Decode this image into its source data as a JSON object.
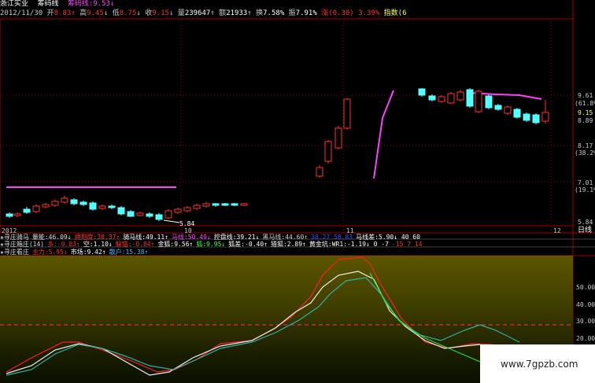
{
  "header": {
    "stock_name": "浙江实业",
    "indicator_name": "筹码线",
    "indicator_value": "9.53",
    "date": "2012/11/30",
    "open_label": "开",
    "open_value": "8.83",
    "high_label": "高",
    "high_value": "9.45",
    "low_label": "低",
    "low_value": "8.75",
    "close_label": "收",
    "close_value": "9.15",
    "volume_label": "量",
    "volume_value": "239647",
    "amount_label": "额",
    "amount_value": "21933",
    "turnover_label": "换",
    "turnover_value": "7.58%",
    "amplitude_label": "振",
    "amplitude_value": "7.91%",
    "change_label": "涨",
    "change_value": "(0.30)",
    "change_pct": "3.39%",
    "index_label": "指数(6"
  },
  "price_axis": {
    "ticks": [
      "9.61",
      "(61.8%)",
      "9.15",
      "8.89",
      "8.17",
      "(38.2%)",
      "7.01",
      "(19.1%)",
      "5.84"
    ],
    "low_marker": "5.84"
  },
  "date_axis": {
    "labels": [
      "2012",
      "10",
      "11",
      "12"
    ],
    "period_label": "日线"
  },
  "indicators": {
    "row1": [
      {
        "t": "寻庄骑马",
        "c": "#dcdcdc"
      },
      {
        "t": "量能:46.09↓",
        "c": "#dcdcdc"
      },
      {
        "t": "拥抱度:38.37↑",
        "c": "#ff3030"
      },
      {
        "t": "骑马线:49.11↑",
        "c": "#ffffff"
      },
      {
        "t": "马线:50.49↓",
        "c": "#ff40ff"
      },
      {
        "t": "控盘线:39.21↓",
        "c": "#ffffff"
      },
      {
        "t": "黑马线:44.60↑",
        "c": "#d0d0d0"
      },
      {
        "t": "38.27 58.83",
        "c": "#3050ff"
      },
      {
        "t": "马线差:5.90↓ 40 60",
        "c": "#ffffff"
      }
    ],
    "row2": [
      {
        "t": "寻庄箱庄(14)",
        "c": "#dcdcdc"
      },
      {
        "t": "多:-0.83↑",
        "c": "#ff3030"
      },
      {
        "t": "空:1.10↓",
        "c": "#ffffff"
      },
      {
        "t": "躲猫:-0.84↑",
        "c": "#ff3030"
      },
      {
        "t": "金狐:9.56↑",
        "c": "#ffffff"
      },
      {
        "t": "狐:9.95↓",
        "c": "#40ff40"
      },
      {
        "t": "狐差:-0.40↑",
        "c": "#ffffff"
      },
      {
        "t": "猎狐:2.89↑",
        "c": "#ffffff"
      },
      {
        "t": "黄金坑:WR1:-1.19↓ 0 -7",
        "c": "#ffffff"
      },
      {
        "t": "-15 7 14",
        "c": "#ff3030"
      }
    ],
    "row3": [
      {
        "t": "寻庄看庄",
        "c": "#dcdcdc"
      },
      {
        "t": "主力:5.95↓",
        "c": "#ff3030"
      },
      {
        "t": "市场:9.42↑",
        "c": "#ffffff"
      },
      {
        "t": "散户:15.38↑",
        "c": "#40c0ff"
      }
    ]
  },
  "indicator_axis": {
    "ticks": [
      "50.00",
      "40.00",
      "30.00",
      "20.00"
    ]
  },
  "watermark": "www.7gpzb.com",
  "colors": {
    "up_candle": "#ff3030",
    "down_candle": "#54ffff",
    "chip_line": "#ff40ff",
    "grid": "#8b0000",
    "border": "#c00000"
  }
}
